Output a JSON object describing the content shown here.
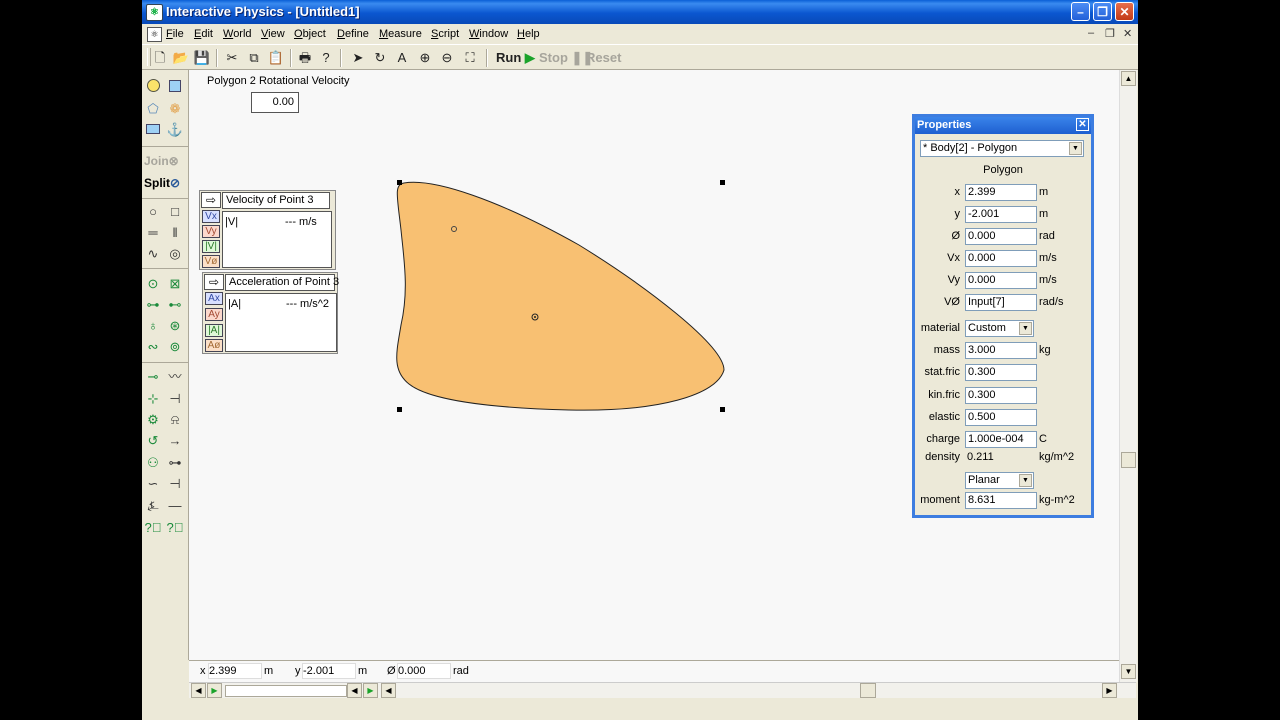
{
  "window": {
    "title": "Interactive Physics - [Untitled1]"
  },
  "menu": [
    "File",
    "Edit",
    "World",
    "View",
    "Object",
    "Define",
    "Measure",
    "Script",
    "Window",
    "Help"
  ],
  "toolbar": {
    "run": "Run",
    "stop": "Stop",
    "reset": "Reset"
  },
  "palette": {
    "join": "Join",
    "split": "Split"
  },
  "rot_meter": {
    "title": "Polygon 2 Rotational Velocity",
    "value": "0.00"
  },
  "velocity_meter": {
    "title": "Velocity of Point 3",
    "chips": [
      "Vx",
      "Vy",
      "|V|",
      "Vø"
    ],
    "readout_label": "|V|",
    "readout_value": "--- m/s"
  },
  "accel_meter": {
    "title": "Acceleration of Point 3",
    "chips": [
      "Ax",
      "Ay",
      "|A|",
      "Aø"
    ],
    "readout_label": "|A|",
    "readout_value": "--- m/s^2"
  },
  "properties": {
    "title": "Properties",
    "object_select": "* Body[2] - Polygon",
    "type": "Polygon",
    "fields": [
      {
        "label": "x",
        "value": "2.399",
        "unit": "m"
      },
      {
        "label": "y",
        "value": "-2.001",
        "unit": "m"
      },
      {
        "label": "Ø",
        "value": "0.000",
        "unit": "rad"
      },
      {
        "label": "Vx",
        "value": "0.000",
        "unit": "m/s"
      },
      {
        "label": "Vy",
        "value": "0.000",
        "unit": "m/s"
      },
      {
        "label": "VØ",
        "value": "Input[7]",
        "unit": "rad/s"
      }
    ],
    "material_label": "material",
    "material_value": "Custom",
    "fields2": [
      {
        "label": "mass",
        "value": "3.000",
        "unit": "kg"
      },
      {
        "label": "stat.fric",
        "value": "0.300",
        "unit": ""
      },
      {
        "label": "kin.fric",
        "value": "0.300",
        "unit": ""
      },
      {
        "label": "elastic",
        "value": "0.500",
        "unit": ""
      },
      {
        "label": "charge",
        "value": "1.000e-004",
        "unit": "C"
      }
    ],
    "density_label": "density",
    "density_value": "0.211",
    "density_unit": "kg/m^2",
    "planar": "Planar",
    "moment_label": "moment",
    "moment_value": "8.631",
    "moment_unit": "kg-m^2"
  },
  "status": {
    "x_label": "x",
    "x_value": "2.399",
    "x_unit": "m",
    "y_label": "y",
    "y_value": "-2.001",
    "y_unit": "m",
    "o_label": "Ø",
    "o_value": "0.000",
    "o_unit": "rad"
  },
  "colors": {
    "polygon_fill": "#f8c072",
    "titlebar": "#0b57d0"
  }
}
